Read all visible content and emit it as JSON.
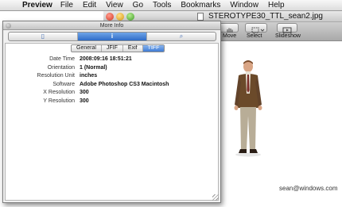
{
  "menubar": {
    "apple_icon": "apple-logo",
    "app_name": "Preview",
    "items": [
      "File",
      "Edit",
      "View",
      "Go",
      "Tools",
      "Bookmarks",
      "Window",
      "Help"
    ]
  },
  "preview_window": {
    "title": "STEROTYPE30_TTL_sean2.jpg",
    "toolbar": [
      {
        "label": "Move",
        "icon": "hand-icon"
      },
      {
        "label": "Select",
        "icon": "marquee-select-icon"
      },
      {
        "label": "Slideshow",
        "icon": "slideshow-icon"
      }
    ],
    "watermark": "sean@windows.com"
  },
  "info_panel": {
    "title": "More Info",
    "segments": [
      {
        "icon": "document-icon",
        "glyph": "▯"
      },
      {
        "icon": "info-icon",
        "glyph": "i"
      },
      {
        "icon": "search-icon",
        "glyph": "⌕"
      }
    ],
    "subtabs": [
      "General",
      "JFIF",
      "Exif",
      "TIFF"
    ],
    "active_subtab": "TIFF",
    "properties": [
      {
        "key": "Date Time",
        "value": "2008:09:16 18:51:21"
      },
      {
        "key": "Orientation",
        "value": "1 (Normal)"
      },
      {
        "key": "Resolution Unit",
        "value": "inches"
      },
      {
        "key": "Software",
        "value": "Adobe Photoshop CS3 Macintosh"
      },
      {
        "key": "X Resolution",
        "value": "300"
      },
      {
        "key": "Y Resolution",
        "value": "300"
      }
    ]
  },
  "colors": {
    "accent": "#3f7bd4",
    "menubar": "#e6e6e6",
    "close": "#d8361f",
    "minimize": "#d99a12",
    "zoom": "#3e9e27"
  }
}
